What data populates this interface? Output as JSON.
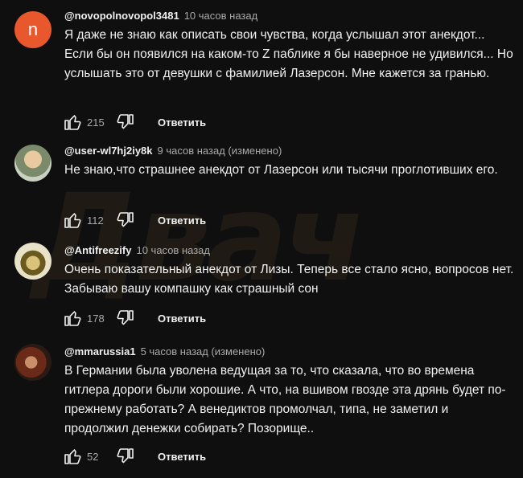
{
  "watermark": "Двач",
  "reply_label": "Ответить",
  "comments": [
    {
      "avatar_letter": "n",
      "author": "@novopolnovopol3481",
      "time": "10 часов назад",
      "text": "Я даже не знаю как описать свои чувства, когда услышал этот анекдот... Если бы он появился на каком-то Z паблике я бы наверное не удивился... Но услышать это от девушки с фамилией Лазерсон. Мне кажется за гранью.",
      "likes": "215"
    },
    {
      "author": "@user-wl7hj2iy8k",
      "time": "9 часов назад (изменено)",
      "text": "Не знаю,что страшнее анекдот от Лазерсон или  тысячи проглотивших его.",
      "likes": "112"
    },
    {
      "author": "@Antifreezify",
      "time": "10 часов назад",
      "text": "Очень показательный анекдот от Лизы. Теперь все стало ясно, вопросов нет. Забываю вашу компашку как страшный сон",
      "likes": "178"
    },
    {
      "author": "@mmarussia1",
      "time": "5 часов назад (изменено)",
      "text": "В Германии была уволена ведущая за то, что сказала, что во времена гитлера дороги были хорошие. А что, на вшивом гвозде эта дрянь будет по-прежнему работать? А венедиктов  промолчал, типа, не заметил и продолжил денежки собирать? Позорище..",
      "likes": "52"
    }
  ]
}
